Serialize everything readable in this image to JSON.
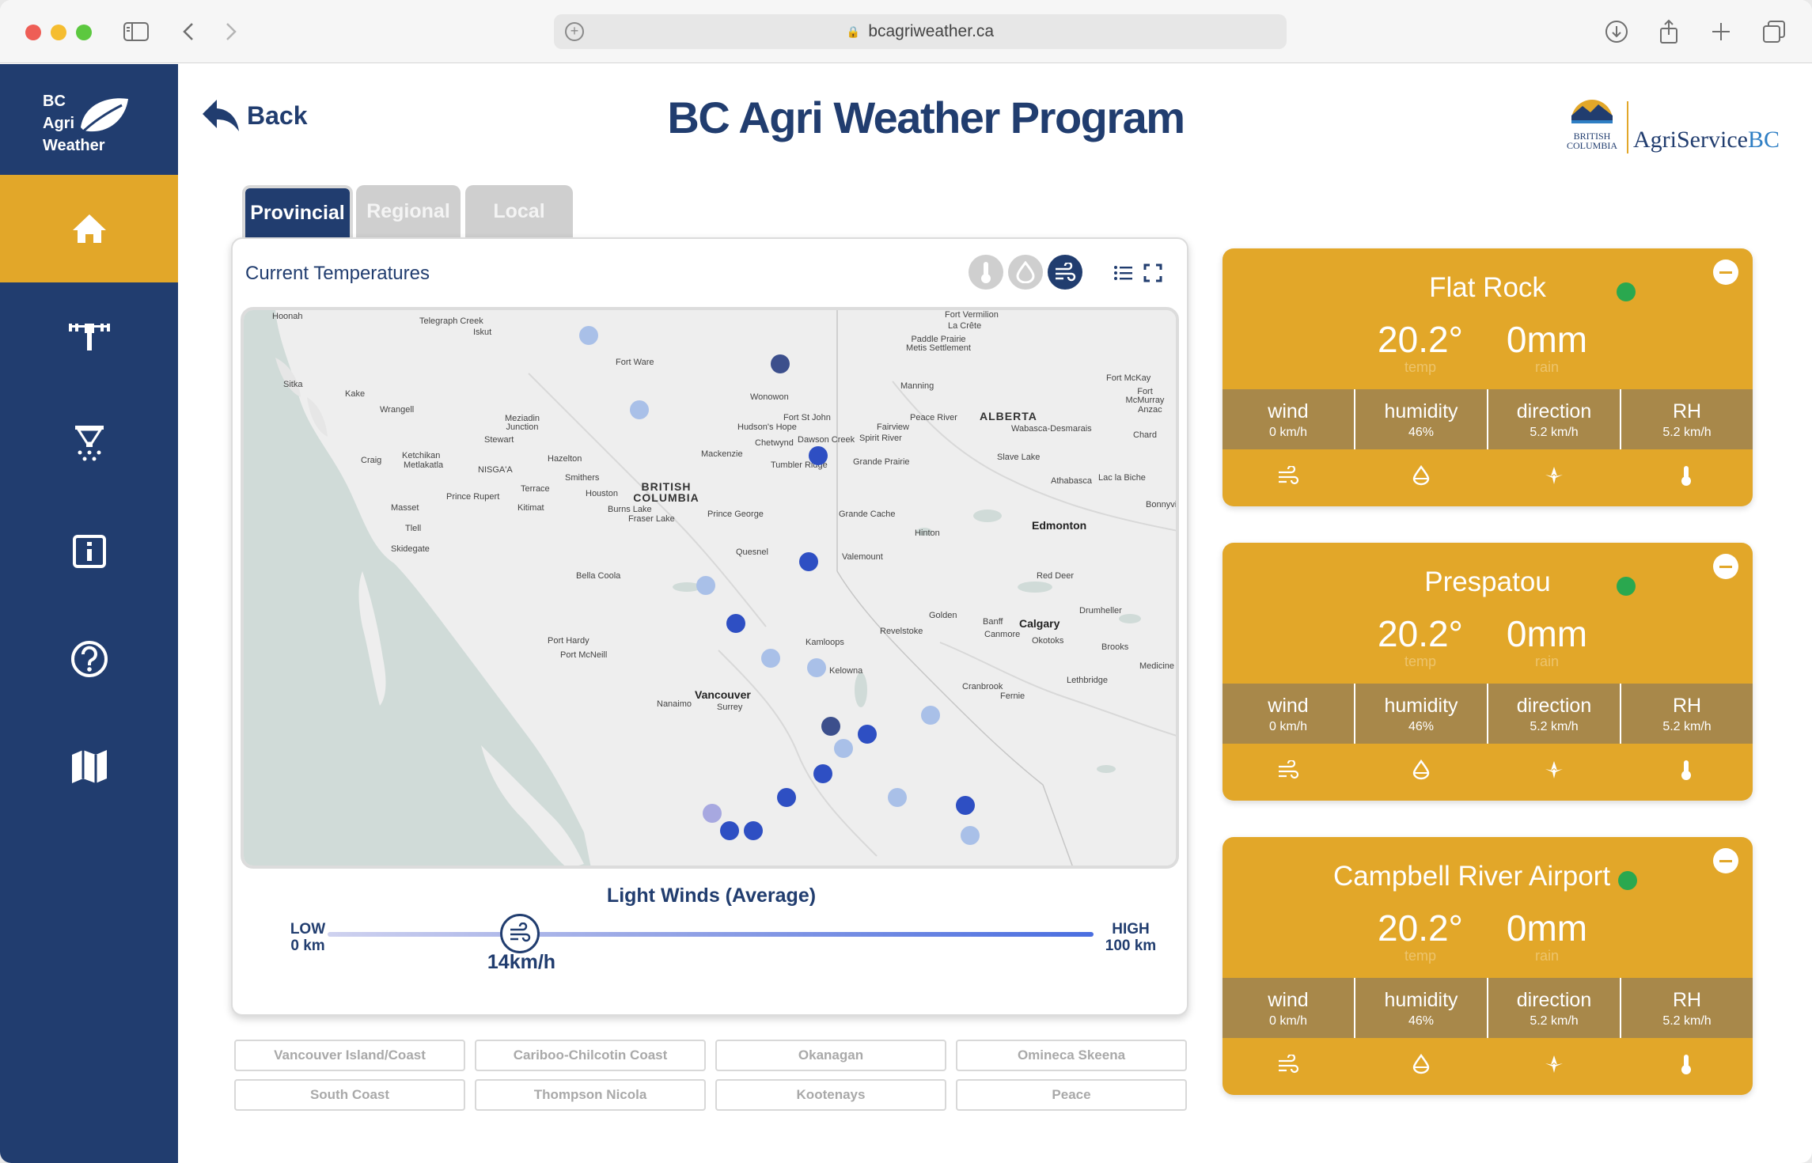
{
  "browser": {
    "url": "bcagriweather.ca"
  },
  "sidebar": {
    "logo_lines": [
      "BC",
      "Agri",
      "Weather"
    ],
    "items": [
      {
        "name": "home",
        "icon": "home-icon"
      },
      {
        "name": "weather-station",
        "icon": "weather-station-icon"
      },
      {
        "name": "irrigation",
        "icon": "sprinkler-icon"
      },
      {
        "name": "info",
        "icon": "info-icon"
      },
      {
        "name": "help",
        "icon": "help-icon"
      },
      {
        "name": "map",
        "icon": "map-icon"
      }
    ]
  },
  "header": {
    "back_label": "Back",
    "title": "BC Agri Weather Program",
    "brand_bc_line1": "BRITISH",
    "brand_bc_line2": "COLUMBIA",
    "brand_agri": "AgriService",
    "brand_bc": "BC"
  },
  "tabs": [
    {
      "label": "Provincial",
      "active": true
    },
    {
      "label": "Regional",
      "active": false
    },
    {
      "label": "Local",
      "active": false
    }
  ],
  "map_card": {
    "title": "Current Temperatures",
    "legend_title": "Light Winds (Average)",
    "low_label": "LOW",
    "low_value": "0 km",
    "high_label": "HIGH",
    "high_value": "100 km",
    "current_value": "14km/h",
    "slider_fraction": 0.14
  },
  "map": {
    "labels": [
      "Hoonah",
      "Telegraph Creek",
      "Iskut",
      "Fort Ware",
      "Fort Vermilion",
      "La Crête",
      "Paddle Prairie Metis Settlement",
      "Fort McKay",
      "Fort McMurray",
      "Sitka",
      "Kake",
      "Wrangell",
      "Wonowon",
      "Manning",
      "Meziadin Junction",
      "Stewart",
      "Fort St John",
      "Hudson's Hope",
      "Peace River",
      "ALBERTA",
      "Fairview",
      "Wabasca-Desmarais",
      "Anzac",
      "Chetwynd",
      "Dawson Creek",
      "Spirit River",
      "Chard",
      "Ketchikan",
      "Metlakatla",
      "Craig",
      "NISGA'A",
      "Hazelton",
      "Mackenzie",
      "Tumbler Ridge",
      "Grande Prairie",
      "Slave Lake",
      "Smithers",
      "Athabasca",
      "Lac la Biche",
      "Terrace",
      "Prince Rupert",
      "BRITISH COLUMBIA",
      "Houston",
      "Kitimat",
      "Burns Lake",
      "Fraser Lake",
      "Prince George",
      "Grande Cache",
      "Bonnyville",
      "Masset",
      "Tlell",
      "Hinton",
      "Edmonton",
      "Skidegate",
      "Quesnel",
      "Valemount",
      "Bella Coola",
      "Red Deer",
      "Drumheller",
      "Golden",
      "Banff",
      "Calgary",
      "Canmore",
      "Okotoks",
      "Revelstoke",
      "Kamloops",
      "Brooks",
      "Port Hardy",
      "Port McNeill",
      "Medicine Hat",
      "Kelowna",
      "Lethbridge",
      "Cranbrook",
      "Fernie",
      "Vancouver",
      "Nanaimo",
      "Surrey"
    ]
  },
  "regions": [
    "Vancouver Island/Coast",
    "Cariboo-Chilcotin Coast",
    "Okanagan",
    "Omineca Skeena",
    "South Coast",
    "Thompson Nicola",
    "Kootenays",
    "Peace"
  ],
  "stations": [
    {
      "name": "Flat Rock",
      "temp": "20.2°",
      "temp_label": "temp",
      "rain": "0mm",
      "rain_label": "rain",
      "stats": [
        {
          "label": "wind",
          "value": "0 km/h"
        },
        {
          "label": "humidity",
          "value": "46%"
        },
        {
          "label": "direction",
          "value": "5.2 km/h"
        },
        {
          "label": "RH",
          "value": "5.2 km/h"
        }
      ]
    },
    {
      "name": "Prespatou",
      "temp": "20.2°",
      "temp_label": "temp",
      "rain": "0mm",
      "rain_label": "rain",
      "stats": [
        {
          "label": "wind",
          "value": "0 km/h"
        },
        {
          "label": "humidity",
          "value": "46%"
        },
        {
          "label": "direction",
          "value": "5.2 km/h"
        },
        {
          "label": "RH",
          "value": "5.2 km/h"
        }
      ]
    },
    {
      "name": "Campbell River Airport",
      "temp": "20.2°",
      "temp_label": "temp",
      "rain": "0mm",
      "rain_label": "rain",
      "stats": [
        {
          "label": "wind",
          "value": "0 km/h"
        },
        {
          "label": "humidity",
          "value": "46%"
        },
        {
          "label": "direction",
          "value": "5.2 km/h"
        },
        {
          "label": "RH",
          "value": "5.2 km/h"
        }
      ]
    }
  ],
  "colors": {
    "navy": "#213d6f",
    "gold": "#e2a729",
    "status_online": "#2aa84f"
  }
}
